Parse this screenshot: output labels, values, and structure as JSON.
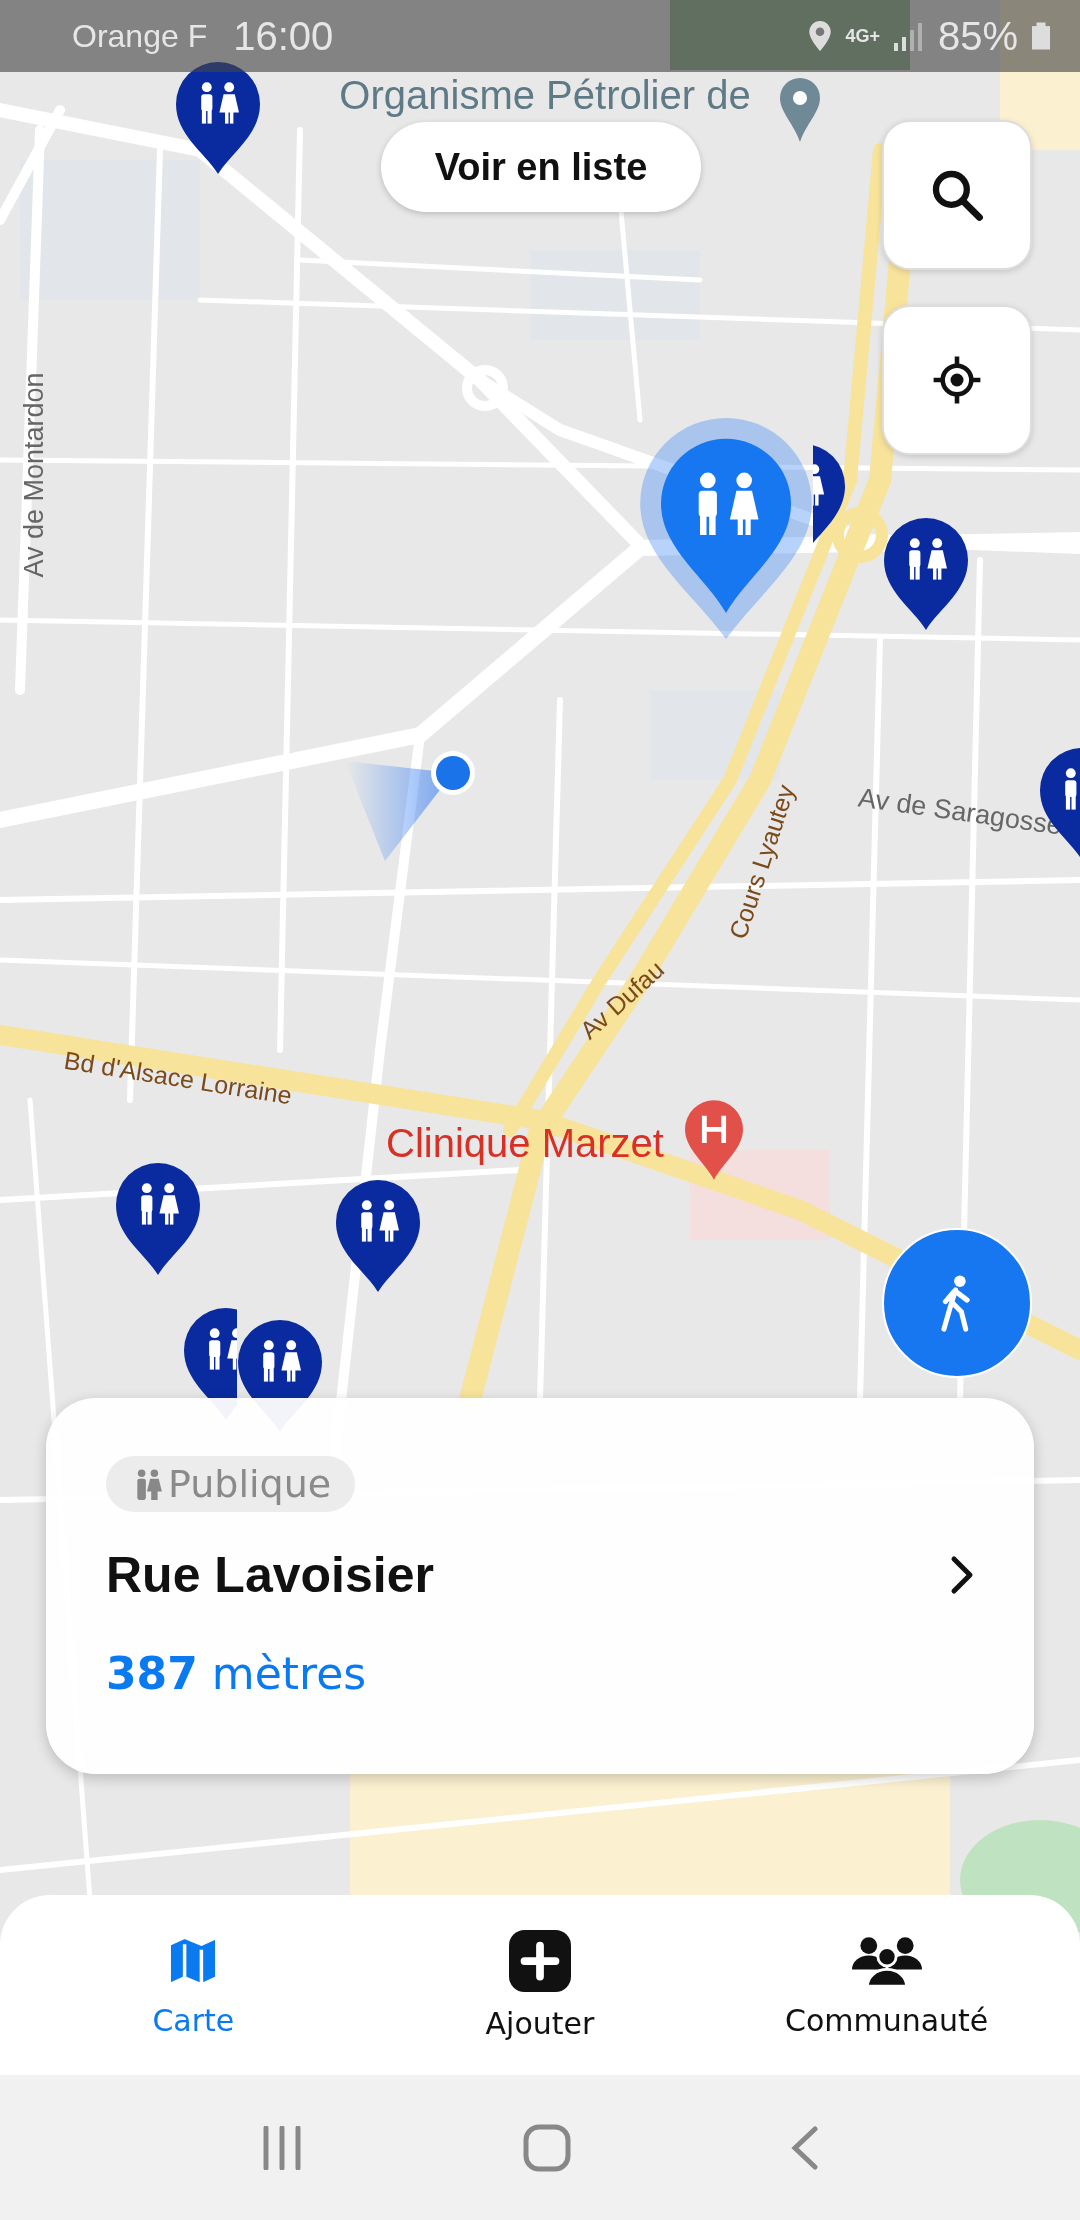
{
  "status_bar": {
    "carrier": "Orange F",
    "time": "16:00",
    "network": "4G+",
    "battery": "85%"
  },
  "map": {
    "labels": [
      {
        "text": "Organisme Pétrolier de",
        "kind": "poi"
      },
      {
        "text": "Av de Montardon",
        "kind": "street"
      },
      {
        "text": "Av de Saragosse",
        "kind": "street"
      },
      {
        "text": "Cours Lyautey",
        "kind": "main"
      },
      {
        "text": "Av Dufau",
        "kind": "main"
      },
      {
        "text": "Bd d'Alsace Lorraine",
        "kind": "main"
      },
      {
        "text": "Clinique Marzet",
        "kind": "hospital"
      }
    ],
    "pins": [
      {
        "selected": false
      },
      {
        "selected": false
      },
      {
        "selected": false
      },
      {
        "selected": false
      },
      {
        "selected": false
      },
      {
        "selected": false
      },
      {
        "selected": false
      },
      {
        "selected": false
      },
      {
        "selected": true
      }
    ]
  },
  "list_button": "Voir en liste",
  "card": {
    "tag": "Publique",
    "title": "Rue Lavoisier",
    "distance": "**387** mètres"
  },
  "nav": [
    {
      "label": "Carte",
      "selected": true
    },
    {
      "label": "Ajouter",
      "selected": false
    },
    {
      "label": "Communauté",
      "selected": false
    }
  ]
}
